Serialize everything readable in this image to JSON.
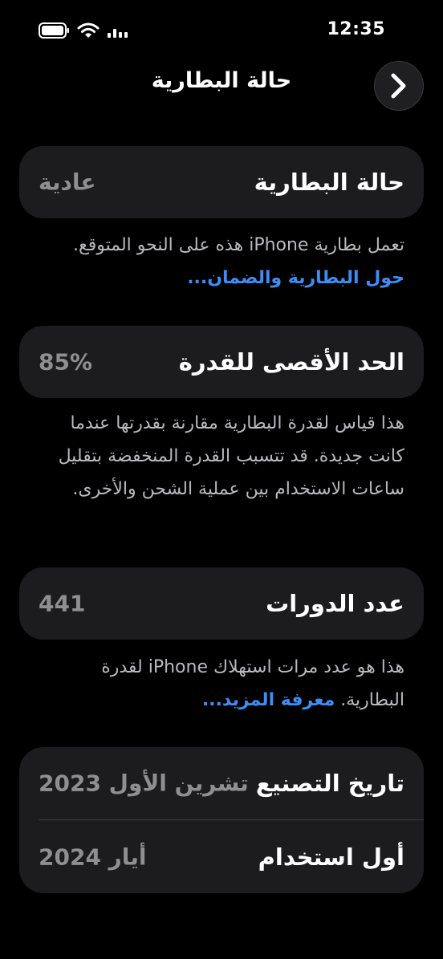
{
  "status_bar": {
    "time": "12:35",
    "icons": [
      "battery-icon",
      "wifi-icon",
      "signal-icon"
    ]
  },
  "nav": {
    "title": "حالة البطارية",
    "back_icon": "chevron-right-icon"
  },
  "battery_health": {
    "label": "حالة البطارية",
    "value": "عادية",
    "description": "تعمل بطارية iPhone هذه على النحو المتوقع.",
    "link": "حول البطارية والضمان..."
  },
  "max_capacity": {
    "label": "الحد الأقصى للقدرة",
    "value": "85%",
    "description": "هذا قياس لقدرة البطارية مقارنة بقدرتها عندما كانت جديدة. قد تتسبب القدرة المنخفضة بتقليل ساعات الاستخدام بين عملية الشحن والأخرى."
  },
  "cycle_count": {
    "label": "عدد الدورات",
    "value": "441",
    "description": "هذا هو عدد مرات استهلاك iPhone لقدرة البطارية.",
    "link": "معرفة المزيد..."
  },
  "dates": {
    "manufacture_label": "تاريخ التصنيع",
    "manufacture_value": "تشرين الأول 2023",
    "first_use_label": "أول استخدام",
    "first_use_value": "أيار 2024"
  },
  "colors": {
    "background": "#000000",
    "card": "#1c1c1e",
    "link": "#3d8ef7",
    "secondary_text": "#8e8e93"
  }
}
